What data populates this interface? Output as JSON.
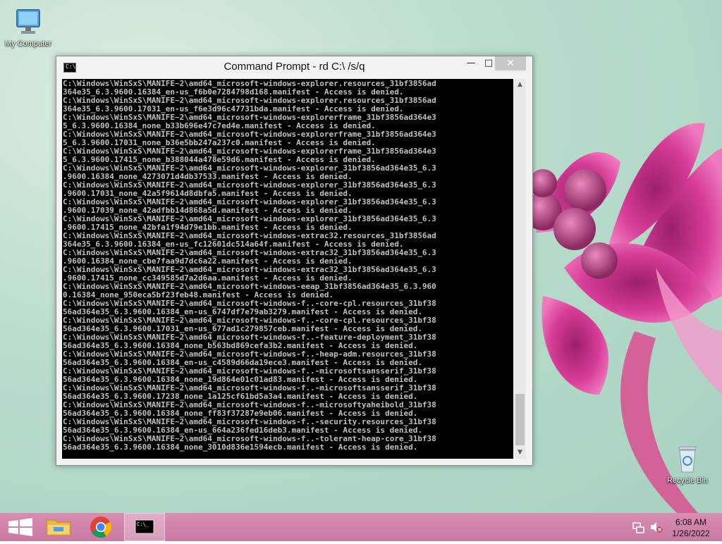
{
  "desktop": {
    "icons": [
      {
        "label": "My Computer",
        "icon": "computer-icon"
      },
      {
        "label": "Recycle Bin",
        "icon": "recycle-bin-icon"
      }
    ]
  },
  "window": {
    "title": "Command Prompt - rd  C:\\ /s/q",
    "icon": "cmd-icon",
    "min_label": "—",
    "max_label": "□",
    "close_label": "✕",
    "console_lines": [
      "C:\\Windows\\WinSxS\\MANIFE~2\\amd64_microsoft-windows-explorer.resources_31bf3856ad",
      "364e35_6.3.9600.16384_en-us_f6b0e7284798d168.manifest - Access is denied.",
      "C:\\Windows\\WinSxS\\MANIFE~2\\amd64_microsoft-windows-explorer.resources_31bf3856ad",
      "364e35_6.3.9600.17031_en-us_f6e3d96c47731bda.manifest - Access is denied.",
      "C:\\Windows\\WinSxS\\MANIFE~2\\amd64_microsoft-windows-explorerframe_31bf3856ad364e3",
      "5_6.3.9600.16384_none_b33b696e47c7ed4e.manifest - Access is denied.",
      "C:\\Windows\\WinSxS\\MANIFE~2\\amd64_microsoft-windows-explorerframe_31bf3856ad364e3",
      "5_6.3.9600.17031_none_b36e5bb247a237c0.manifest - Access is denied.",
      "C:\\Windows\\WinSxS\\MANIFE~2\\amd64_microsoft-windows-explorerframe_31bf3856ad364e3",
      "5_6.3.9600.17415_none_b388044a478e59d6.manifest - Access is denied.",
      "C:\\Windows\\WinSxS\\MANIFE~2\\amd64_microsoft-windows-explorer_31bf3856ad364e35_6.3",
      ".9600.16384_none_4273071d4db37533.manifest - Access is denied.",
      "C:\\Windows\\WinSxS\\MANIFE~2\\amd64_microsoft-windows-explorer_31bf3856ad364e35_6.3",
      ".9600.17031_none_42a5f9614d8dbfa5.manifest - Access is denied.",
      "C:\\Windows\\WinSxS\\MANIFE~2\\amd64_microsoft-windows-explorer_31bf3856ad364e35_6.3",
      ".9600.17039_none_42adfbb14d868a5d.manifest - Access is denied.",
      "C:\\Windows\\WinSxS\\MANIFE~2\\amd64_microsoft-windows-explorer_31bf3856ad364e35_6.3",
      ".9600.17415_none_42bfa1f94d79e1bb.manifest - Access is denied.",
      "C:\\Windows\\WinSxS\\MANIFE~2\\amd64_microsoft-windows-extrac32.resources_31bf3856ad",
      "364e35_6.3.9600.16384_en-us_fc12601dc514a64f.manifest - Access is denied.",
      "C:\\Windows\\WinSxS\\MANIFE~2\\amd64_microsoft-windows-extrac32_31bf3856ad364e35_6.3",
      ".9600.16384_none_cbe7faa9d7dc6a22.manifest - Access is denied.",
      "C:\\Windows\\WinSxS\\MANIFE~2\\amd64_microsoft-windows-extrac32_31bf3856ad364e35_6.3",
      ".9600.17415_none_cc349585d7a2d6aa.manifest - Access is denied.",
      "C:\\Windows\\WinSxS\\MANIFE~2\\amd64_microsoft-windows-eeap_31bf3856ad364e35_6.3.960",
      "0.16384_none_950eca5bf23feb48.manifest - Access is denied.",
      "C:\\Windows\\WinSxS\\MANIFE~2\\amd64_microsoft-windows-f..-core-cpl.resources_31bf38",
      "56ad364e35_6.3.9600.16384_en-us_6747df7e79ab3279.manifest - Access is denied.",
      "C:\\Windows\\WinSxS\\MANIFE~2\\amd64_microsoft-windows-f..-core-cpl.resources_31bf38",
      "56ad364e35_6.3.9600.17031_en-us_677ad1c279857ceb.manifest - Access is denied.",
      "C:\\Windows\\WinSxS\\MANIFE~2\\amd64_microsoft-windows-f..-feature-deployment_31bf38",
      "56ad364e35_6.3.9600.16384_none_b563bd869cefa3b2.manifest - Access is denied.",
      "C:\\Windows\\WinSxS\\MANIFE~2\\amd64_microsoft-windows-f..-heap-adm.resources_31bf38",
      "56ad364e35_6.3.9600.16384_en-us_c4589d66da19ece3.manifest - Access is denied.",
      "C:\\Windows\\WinSxS\\MANIFE~2\\amd64_microsoft-windows-f..-microsoftsansserif_31bf38",
      "56ad364e35_6.3.9600.16384_none_19d864e01c01ad83.manifest - Access is denied.",
      "C:\\Windows\\WinSxS\\MANIFE~2\\amd64_microsoft-windows-f..-microsoftsansserif_31bf38",
      "56ad364e35_6.3.9600.17238_none_1a125cf61bd5a3a4.manifest - Access is denied.",
      "C:\\Windows\\WinSxS\\MANIFE~2\\amd64_microsoft-windows-f..-microsoftyaheibold_31bf38",
      "56ad364e35_6.3.9600.16384_none_ff83f37287e9eb06.manifest - Access is denied.",
      "C:\\Windows\\WinSxS\\MANIFE~2\\amd64_microsoft-windows-f..-security.resources_31bf38",
      "56ad364e35_6.3.9600.16384_en-us_664a236fed16deb3.manifest - Access is denied.",
      "C:\\Windows\\WinSxS\\MANIFE~2\\amd64_microsoft-windows-f..-tolerant-heap-core_31bf38",
      "56ad364e35_6.3.9600.16384_none_3010d836e1594ecb.manifest - Access is denied."
    ],
    "scroll_position": 0.93
  },
  "taskbar": {
    "items": [
      {
        "name": "start-button",
        "icon": "windows-logo-icon"
      },
      {
        "name": "file-explorer-button",
        "icon": "folder-icon"
      },
      {
        "name": "chrome-button",
        "icon": "chrome-icon"
      },
      {
        "name": "cmd-taskbar-button",
        "icon": "cmd-icon",
        "active": true
      }
    ],
    "tray": {
      "network_icon": "network-icon",
      "volume_icon": "volume-muted-icon",
      "time": "6:08 AM",
      "date": "1/26/2022"
    }
  }
}
